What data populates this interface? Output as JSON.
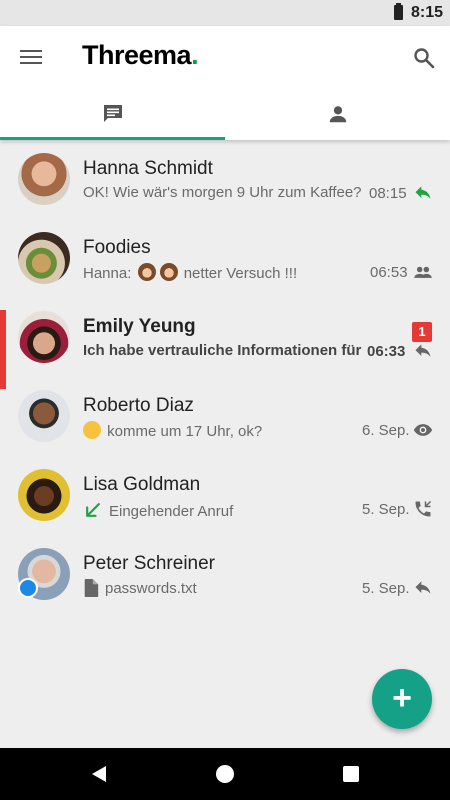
{
  "status_bar": {
    "time": "8:15",
    "icons": [
      "battery-icon"
    ]
  },
  "app_bar": {
    "logo_text": "Threema",
    "logo_dot": ".",
    "icons": [
      "menu-icon",
      "search-icon"
    ]
  },
  "tabs": [
    {
      "name": "chats",
      "icon": "chat-icon",
      "selected": true
    },
    {
      "name": "contacts",
      "icon": "person-icon",
      "selected": false
    }
  ],
  "colors": {
    "accent": "#1b9e86",
    "brand_green": "#05a63f",
    "unread_red": "#e53935",
    "fab": "#15a088"
  },
  "conversations": [
    {
      "name": "Hanna Schmidt",
      "preview": "OK! Wie wär's morgen 9 Uhr zum Kaffee?",
      "time": "08:15",
      "status_icon": "reply-icon-green",
      "unread": false
    },
    {
      "name": "Foodies",
      "preview_prefix": "Hanna:",
      "preview_emojis": [
        "see-no-evil-monkey",
        "see-no-evil-monkey"
      ],
      "preview_suffix": "netter Versuch !!!",
      "time": "06:53",
      "status_icon": "group-icon",
      "unread": false
    },
    {
      "name": "Emily Yeung",
      "preview": "Ich habe vertrauliche Informationen für d",
      "time": "06:33",
      "status_icon": "reply-icon",
      "unread": true,
      "unread_count": "1"
    },
    {
      "name": "Roberto Diaz",
      "preview_emoji": "winking-face",
      "preview": "komme um 17 Uhr, ok?",
      "time": "6. Sep.",
      "status_icon": "eye-icon",
      "unread": false
    },
    {
      "name": "Lisa Goldman",
      "preview_icon": "incoming-call-arrow-icon",
      "preview": "Eingehender Anruf",
      "time": "5. Sep.",
      "status_icon": "phone-callback-icon",
      "unread": false
    },
    {
      "name": "Peter Schreiner",
      "preview_icon": "file-icon",
      "preview": "passwords.txt",
      "time": "5. Sep.",
      "status_icon": "reply-icon",
      "unread": false,
      "avatar_badge": "briefcase-icon"
    }
  ],
  "fab": {
    "label": "+",
    "icon": "add-icon"
  },
  "nav_bar": {
    "icons": [
      "back-icon",
      "home-icon",
      "recents-icon"
    ]
  }
}
